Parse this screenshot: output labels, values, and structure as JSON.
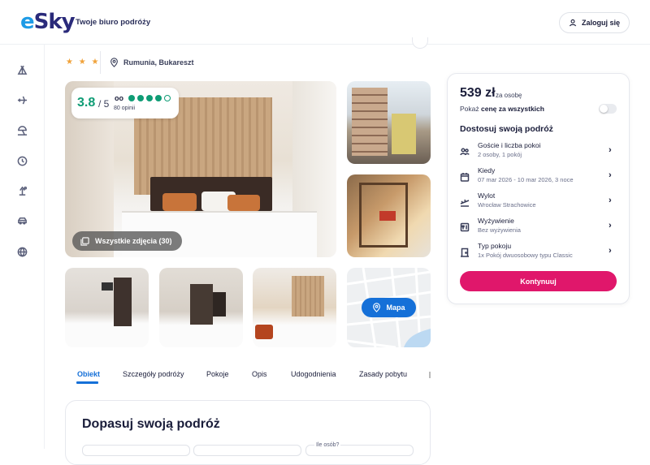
{
  "header": {
    "logo_e": "e",
    "logo_rest": "Sky",
    "tagline": "Twoje biuro podróży",
    "login_label": "Zaloguj się"
  },
  "sidebar": {
    "items": [
      {
        "icon": "tent-icon"
      },
      {
        "icon": "plane-icon"
      },
      {
        "icon": "beach-icon"
      },
      {
        "icon": "clock-icon"
      },
      {
        "icon": "vacation-icon"
      },
      {
        "icon": "car-icon"
      },
      {
        "icon": "globe-icon"
      }
    ]
  },
  "hotel": {
    "stars": "★ ★ ★",
    "location": "Rumunia, Bukareszt"
  },
  "rating": {
    "score": "3.8",
    "max": "/ 5",
    "provider_icon": "oo",
    "reviews": "80 opinii",
    "dots_filled": 4,
    "dots_total": 5
  },
  "gallery": {
    "all_photos_label": "Wszystkie zdjęcia (30)",
    "map_label": "Mapa"
  },
  "tabs": [
    {
      "label": "Obiekt",
      "active": true
    },
    {
      "label": "Szczegóły podróży",
      "active": false
    },
    {
      "label": "Pokoje",
      "active": false
    },
    {
      "label": "Opis",
      "active": false
    },
    {
      "label": "Udogodnienia",
      "active": false
    },
    {
      "label": "Zasady pobytu",
      "active": false
    }
  ],
  "adjust": {
    "title": "Dopasuj swoją podróż",
    "persons_label": "Ile osób?"
  },
  "panel": {
    "price": "539 zł",
    "per_person": "za osobę",
    "show_all_prefix": "Pokaż",
    "show_all_bold": "cenę za wszystkich",
    "toggle_on": false,
    "customize_title": "Dostosuj swoją podróż",
    "options": [
      {
        "icon": "guests-icon",
        "title": "Goście i liczba pokoi",
        "sub": "2 osoby, 1 pokój"
      },
      {
        "icon": "calendar-icon",
        "title": "Kiedy",
        "sub": "07 mar 2026 - 10 mar 2026, 3 noce"
      },
      {
        "icon": "plane-departure-icon",
        "title": "Wylot",
        "sub": "Wrocław Strachowice"
      },
      {
        "icon": "meals-icon",
        "title": "Wyżywienie",
        "sub": "Bez wyżywienia"
      },
      {
        "icon": "door-icon",
        "title": "Typ pokoju",
        "sub": "1x Pokój dwuosobowy typu Classic"
      }
    ],
    "continue_label": "Kontynuuj"
  },
  "colors": {
    "brand_blue": "#1570d8",
    "accent_pink": "#e0176b",
    "rating_green": "#0f9c75",
    "star_orange": "#f0a23a"
  }
}
